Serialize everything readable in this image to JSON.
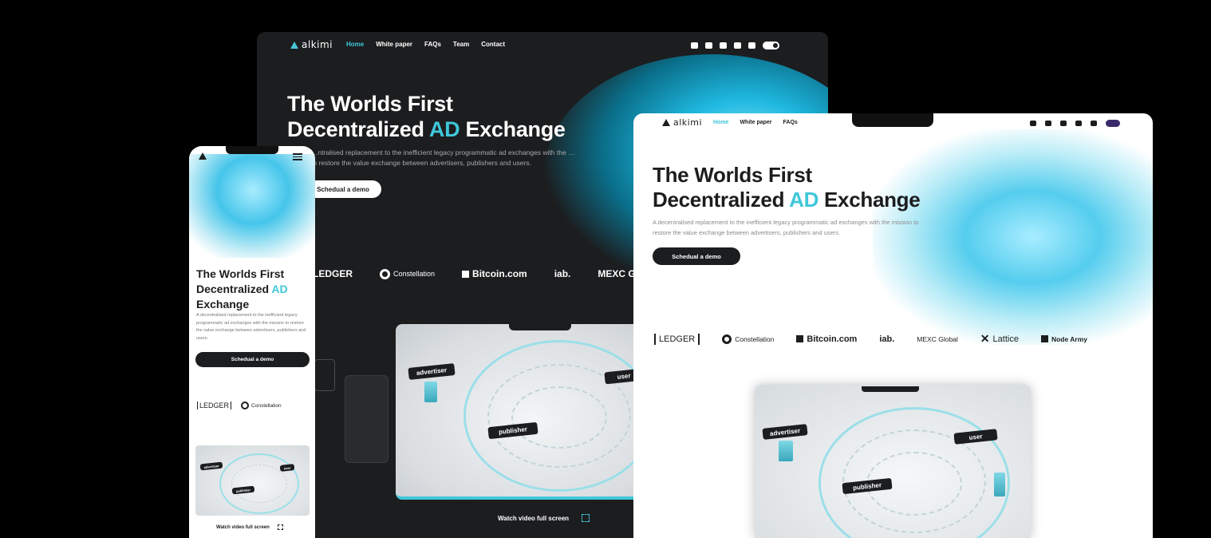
{
  "brand": {
    "name": "alkimi",
    "accent": "#3fc7d9",
    "dark_bg": "#1c1d1f"
  },
  "dark_site": {
    "nav": [
      "Home",
      "White paper",
      "FAQs",
      "Team",
      "Contact"
    ],
    "title_line1": "The Worlds First",
    "title_line2_pre": "Decentralized ",
    "title_accent": "AD",
    "title_line2_post": " Exchange",
    "subtitle": "…ntralised replacement to the inefficient legacy programmatic ad exchanges with the … to restore the value exchange between advertisers, publishers and users.",
    "cta": "Schedual a demo",
    "partners": [
      "LEDGER",
      "Constellation",
      "Bitcoin.com",
      "iab.",
      "MEXC Global"
    ],
    "video_tags": [
      "advertiser",
      "user",
      "publisher"
    ],
    "watch": "Watch video full screen",
    "social_icons": [
      "twitter-icon",
      "discord-icon",
      "youtube-icon",
      "telegram-icon",
      "medium-icon"
    ]
  },
  "phone_site": {
    "title_line1": "The Worlds First",
    "title_line2_pre": "Decentralized ",
    "title_accent": "AD",
    "title_line3": "Exchange",
    "subtitle": "A decentralised replacement to the inefficient legacy programmatic ad exchanges with the mission to restore the value exchange between advertisers, publishers and users.",
    "cta": "Schedual a demo",
    "partners": [
      "LEDGER",
      "Constellation"
    ],
    "video_tags": [
      "advertiser",
      "user",
      "publisher"
    ],
    "watch": "Watch video full screen"
  },
  "light_site": {
    "nav": [
      "Home",
      "White paper",
      "FAQs"
    ],
    "title_line1": "The Worlds First",
    "title_line2_pre": "Decentralized ",
    "title_accent": "AD",
    "title_line2_post": " Exchange",
    "subtitle": "A decentralised replacement to the inefficient legacy programmatic ad exchanges with the mission to restore the value exchange between advertisers, publishers and users.",
    "cta": "Schedual a demo",
    "partners": [
      "LEDGER",
      "Constellation",
      "Bitcoin.com",
      "iab.",
      "MEXC Global",
      "Lattice",
      "Node Army"
    ],
    "video_tags": [
      "advertiser",
      "user",
      "publisher"
    ]
  }
}
